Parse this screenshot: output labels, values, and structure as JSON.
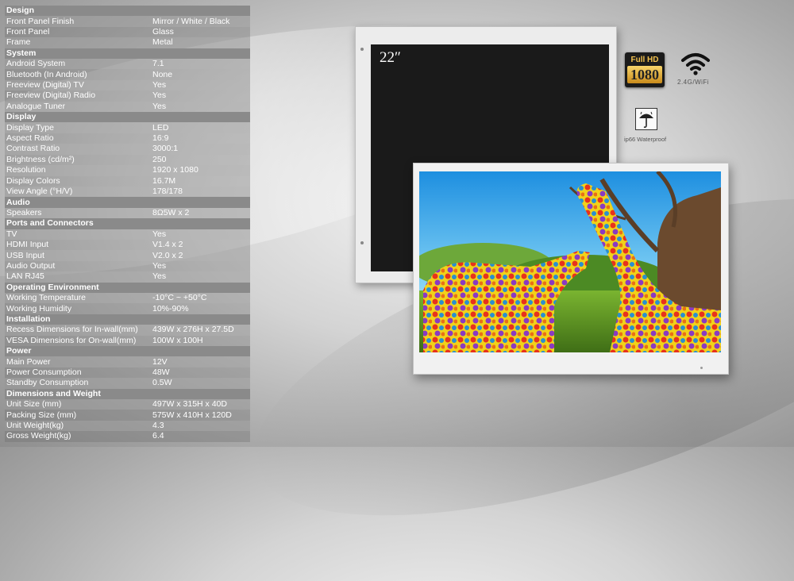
{
  "specs": [
    {
      "type": "head",
      "label": "Design"
    },
    {
      "label": "Front Panel Finish",
      "value": "Mirror / White / Black"
    },
    {
      "label": "Front Panel",
      "value": "Glass"
    },
    {
      "label": "Frame",
      "value": "Metal"
    },
    {
      "type": "head",
      "label": "System"
    },
    {
      "label": "Android System",
      "value": "7.1"
    },
    {
      "label": "Bluetooth (In Android)",
      "value": "None"
    },
    {
      "label": "Freeview (Digital) TV",
      "value": "Yes"
    },
    {
      "label": "Freeview (Digital) Radio",
      "value": "Yes"
    },
    {
      "label": "Analogue Tuner",
      "value": "Yes"
    },
    {
      "type": "head",
      "label": "Display"
    },
    {
      "label": "Display Type",
      "value": "LED"
    },
    {
      "label": "Aspect Ratio",
      "value": "16:9"
    },
    {
      "label": "Contrast Ratio",
      "value": "3000:1"
    },
    {
      "label": "Brightness (cd/m²)",
      "value": "250"
    },
    {
      "label": "Resolution",
      "value": "1920 x 1080"
    },
    {
      "label": "Display Colors",
      "value": "16.7M"
    },
    {
      "label": "View Angle (°H/V)",
      "value": "178/178"
    },
    {
      "type": "head",
      "label": "Audio"
    },
    {
      "label": "Speakers",
      "value": "8Ω5W x 2"
    },
    {
      "type": "head",
      "label": "Ports and Connectors"
    },
    {
      "label": "TV",
      "value": "Yes"
    },
    {
      "label": "HDMI Input",
      "value": "V1.4 x 2"
    },
    {
      "label": "USB Input",
      "value": "V2.0 x 2"
    },
    {
      "label": "Audio Output",
      "value": "Yes"
    },
    {
      "label": "LAN RJ45",
      "value": "Yes"
    },
    {
      "type": "head",
      "label": "Operating Environment"
    },
    {
      "label": "Working Temperature",
      "value": "-10°C ~ +50°C"
    },
    {
      "label": "Working Humidity",
      "value": "10%-90%"
    },
    {
      "type": "head",
      "label": "Installation"
    },
    {
      "label": "Recess Dimensions for In-wall(mm)",
      "value": "439W x 276H x 27.5D"
    },
    {
      "label": "VESA Dimensions for On-wall(mm)",
      "value": "100W x 100H"
    },
    {
      "type": "head",
      "label": "Power"
    },
    {
      "label": "Main Power",
      "value": "12V"
    },
    {
      "label": "Power Consumption",
      "value": "48W"
    },
    {
      "label": "Standby Consumption",
      "value": "0.5W"
    },
    {
      "type": "head",
      "label": "Dimensions and Weight"
    },
    {
      "label": "Unit Size (mm)",
      "value": "497W x 315H x 40D"
    },
    {
      "label": "Packing Size (mm)",
      "value": "575W x 410H x 120D"
    },
    {
      "label": "Unit Weight(kg)",
      "value": "4.3"
    },
    {
      "label": "Gross Weight(kg)",
      "value": "6.4"
    }
  ],
  "monitor": {
    "size_label": "22″"
  },
  "badges": {
    "fullhd_top": "Full HD",
    "fullhd_num": "1080",
    "wifi_icon": "wifi-icon",
    "wifi_label": "2.4G/WiFi",
    "waterproof_icon": "umbrella-icon",
    "waterproof_label": "ip66 Waterproof"
  },
  "colors": {
    "head_row": "#8a8a8a",
    "badge_gold": "#f2c14e"
  }
}
